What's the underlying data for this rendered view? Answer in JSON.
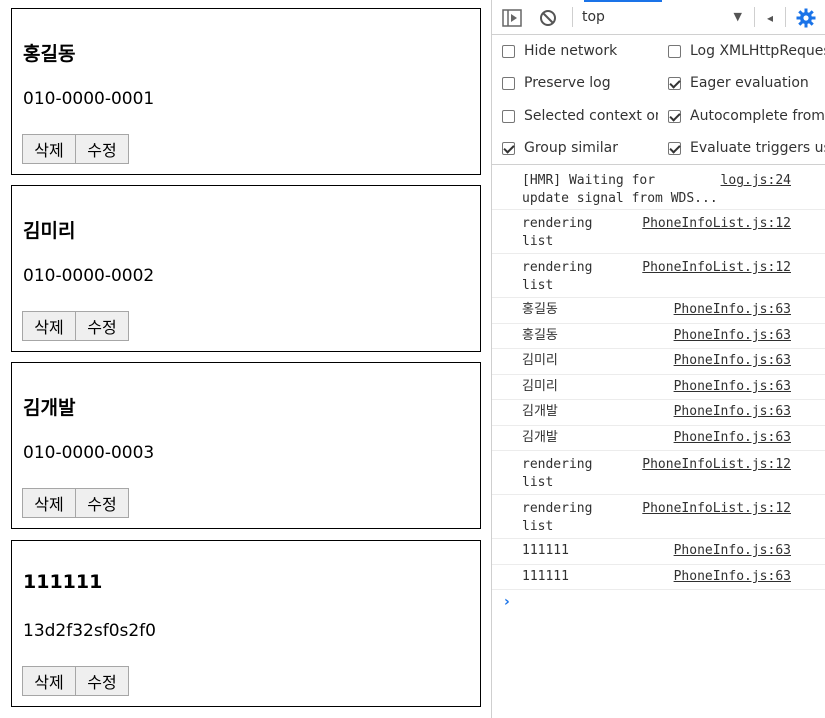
{
  "contacts": [
    {
      "name": "홍길동",
      "phone": "010-0000-0001",
      "delete_label": "삭제",
      "edit_label": "수정"
    },
    {
      "name": "김미리",
      "phone": "010-0000-0002",
      "delete_label": "삭제",
      "edit_label": "수정"
    },
    {
      "name": "김개발",
      "phone": "010-0000-0003",
      "delete_label": "삭제",
      "edit_label": "수정"
    },
    {
      "name": "111111",
      "phone": "13d2f32sf0s2f0",
      "delete_label": "삭제",
      "edit_label": "수정"
    }
  ],
  "devtools": {
    "toolbar": {
      "context": "top",
      "icons": [
        "sidebar-toggle-icon",
        "clear-console-icon",
        "chevron-down-icon",
        "left-arrow-icon",
        "gear-icon"
      ],
      "accent_color": "#1a73e8"
    },
    "settings": [
      {
        "label": "Hide network",
        "checked": false
      },
      {
        "label": "Log XMLHttpRequests",
        "checked": false
      },
      {
        "label": "Preserve log",
        "checked": false
      },
      {
        "label": "Eager evaluation",
        "checked": true
      },
      {
        "label": "Selected context only",
        "checked": false
      },
      {
        "label": "Autocomplete from history",
        "checked": true
      },
      {
        "label": "Group similar",
        "checked": true
      },
      {
        "label": "Evaluate triggers user activation",
        "checked": true
      }
    ],
    "logs": [
      {
        "msg": "[HMR] Waiting for\nupdate signal from WDS...",
        "src": "log.js:24"
      },
      {
        "msg": "rendering\nlist",
        "src": "PhoneInfoList.js:12"
      },
      {
        "msg": "rendering\nlist",
        "src": "PhoneInfoList.js:12"
      },
      {
        "msg": "홍길동",
        "src": "PhoneInfo.js:63"
      },
      {
        "msg": "홍길동",
        "src": "PhoneInfo.js:63"
      },
      {
        "msg": "김미리",
        "src": "PhoneInfo.js:63"
      },
      {
        "msg": "김미리",
        "src": "PhoneInfo.js:63"
      },
      {
        "msg": "김개발",
        "src": "PhoneInfo.js:63"
      },
      {
        "msg": "김개발",
        "src": "PhoneInfo.js:63"
      },
      {
        "msg": "rendering\nlist",
        "src": "PhoneInfoList.js:12"
      },
      {
        "msg": "rendering\nlist",
        "src": "PhoneInfoList.js:12"
      },
      {
        "msg": "111111",
        "src": "PhoneInfo.js:63"
      },
      {
        "msg": "111111",
        "src": "PhoneInfo.js:63"
      }
    ],
    "prompt_symbol": "›"
  }
}
